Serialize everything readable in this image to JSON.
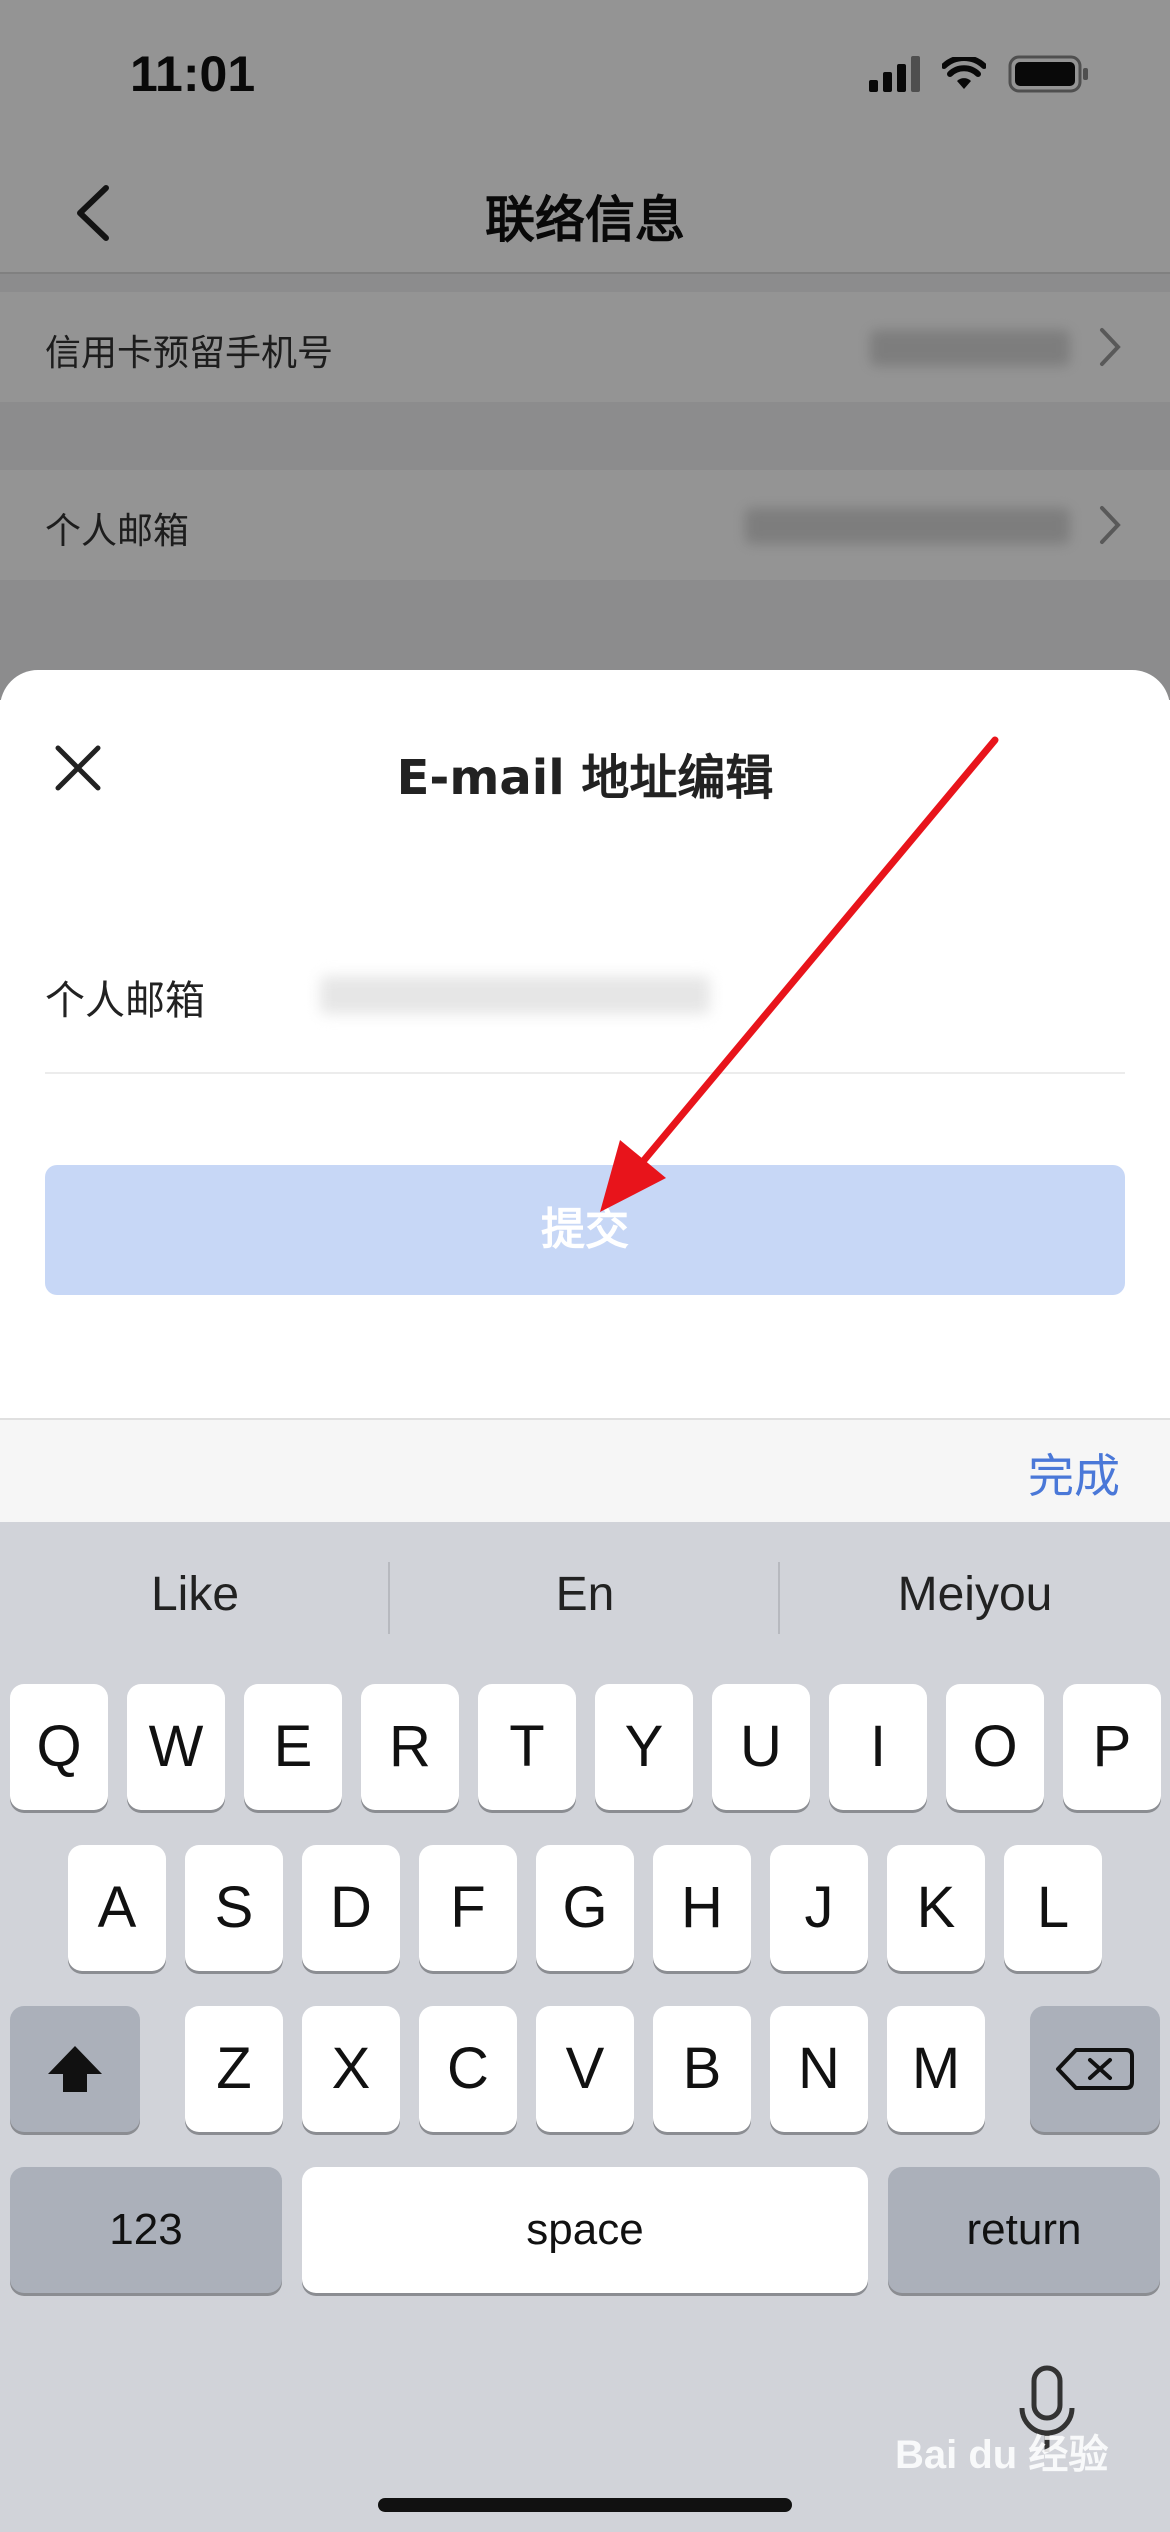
{
  "status_bar": {
    "time": "11:01"
  },
  "nav": {
    "title": "联络信息"
  },
  "rows": [
    {
      "label": "信用卡预留手机号"
    },
    {
      "label": "个人邮箱"
    }
  ],
  "sheet": {
    "title": "E-mail 地址编辑",
    "field_label": "个人邮箱",
    "submit_label": "提交"
  },
  "keyboard": {
    "done_label": "完成",
    "suggestions": [
      "Like",
      "En",
      "Meiyou"
    ],
    "row1": [
      "Q",
      "W",
      "E",
      "R",
      "T",
      "Y",
      "U",
      "I",
      "O",
      "P"
    ],
    "row2": [
      "A",
      "S",
      "D",
      "F",
      "G",
      "H",
      "J",
      "K",
      "L"
    ],
    "row3": [
      "Z",
      "X",
      "C",
      "V",
      "B",
      "N",
      "M"
    ],
    "numbers_label": "123",
    "space_label": "space",
    "return_label": "return"
  },
  "watermark": "Bai du 经验",
  "colors": {
    "accent": "#4a78d8",
    "submit_disabled": "#c7d7f6",
    "annotation_arrow": "#e8141b"
  }
}
